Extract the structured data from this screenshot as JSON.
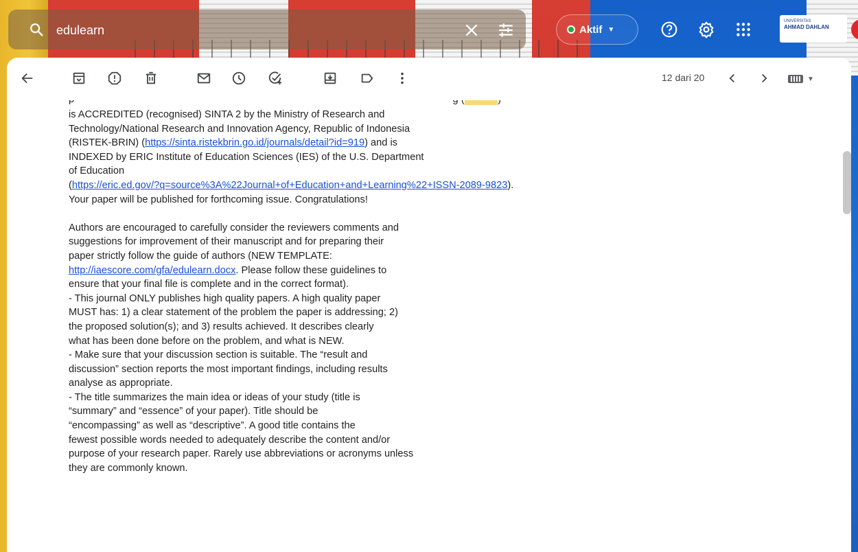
{
  "search": {
    "value": "edulearn"
  },
  "status": {
    "label": "Aktif"
  },
  "org_logo": {
    "line1": "UNIVERSITAS",
    "line2": "AHMAD DAHLAN"
  },
  "pager": {
    "text": "12 dari 20"
  },
  "colors": {
    "accent_link": "#1a4fd6",
    "status_green": "#26a83f"
  },
  "toolbar_icons": [
    "back-arrow-icon",
    "archive-icon",
    "report-spam-icon",
    "delete-icon",
    "mark-unread-icon",
    "snooze-icon",
    "add-task-icon",
    "move-to-icon",
    "label-icon",
    "more-vert-icon"
  ],
  "body": {
    "p1": [
      "is ACCREDITED (recognised) SINTA 2 by the Ministry of Research and",
      "Technology/National Research and Innovation Agency, Republic of Indonesia",
      "INDEXED by ERIC Institute of Education Sciences (IES) of the U.S. Department",
      "of Education",
      "Your paper will be published for forthcoming issue. Congratulations!"
    ],
    "link_sinta": "https://sinta.ristekbrin.go.id/journals/detail?id=919",
    "p1_risteck_prefix": "(RISTEK-BRIN) (",
    "p1_risteck_suffix": ") and is",
    "link_eric": "https://eric.ed.gov/?q=source%3A%22Journal+of+Education+and+Learning%22+ISSN-2089-9823",
    "p1_eric_prefix": "(",
    "p1_eric_suffix": ").",
    "p2": [
      "Authors are encouraged to carefully consider the reviewers comments and",
      "suggestions for improvement of their manuscript and for preparing their",
      "paper strictly follow the guide of authors (NEW TEMPLATE:"
    ],
    "link_template": "http://iaescore.com/gfa/edulearn.docx",
    "p2_after_link": ". Please follow these guidelines to",
    "p3": [
      "ensure that your final file is complete and in the correct format).",
      "-  This journal ONLY publishes high quality papers. A high quality paper",
      "MUST has: 1) a clear statement of the problem the paper is addressing; 2)",
      "the proposed solution(s); and 3) results achieved.  It describes clearly",
      "what has been done before on the problem, and what is NEW.",
      "- Make sure that your discussion section is suitable. The “result and",
      "discussion” section reports the most important findings, including results",
      "analyse as appropriate.",
      "-  The title summarizes the main idea or ideas of your study (title is",
      "“summary” and “essence”  of your paper). Title should be",
      "“encompassing” as well as “descriptive”. A good title contains the",
      "fewest possible words needed to adequately describe the content and/or",
      "purpose of your research paper. Rarely use abbreviations or acronyms unless",
      "they are commonly known."
    ]
  }
}
